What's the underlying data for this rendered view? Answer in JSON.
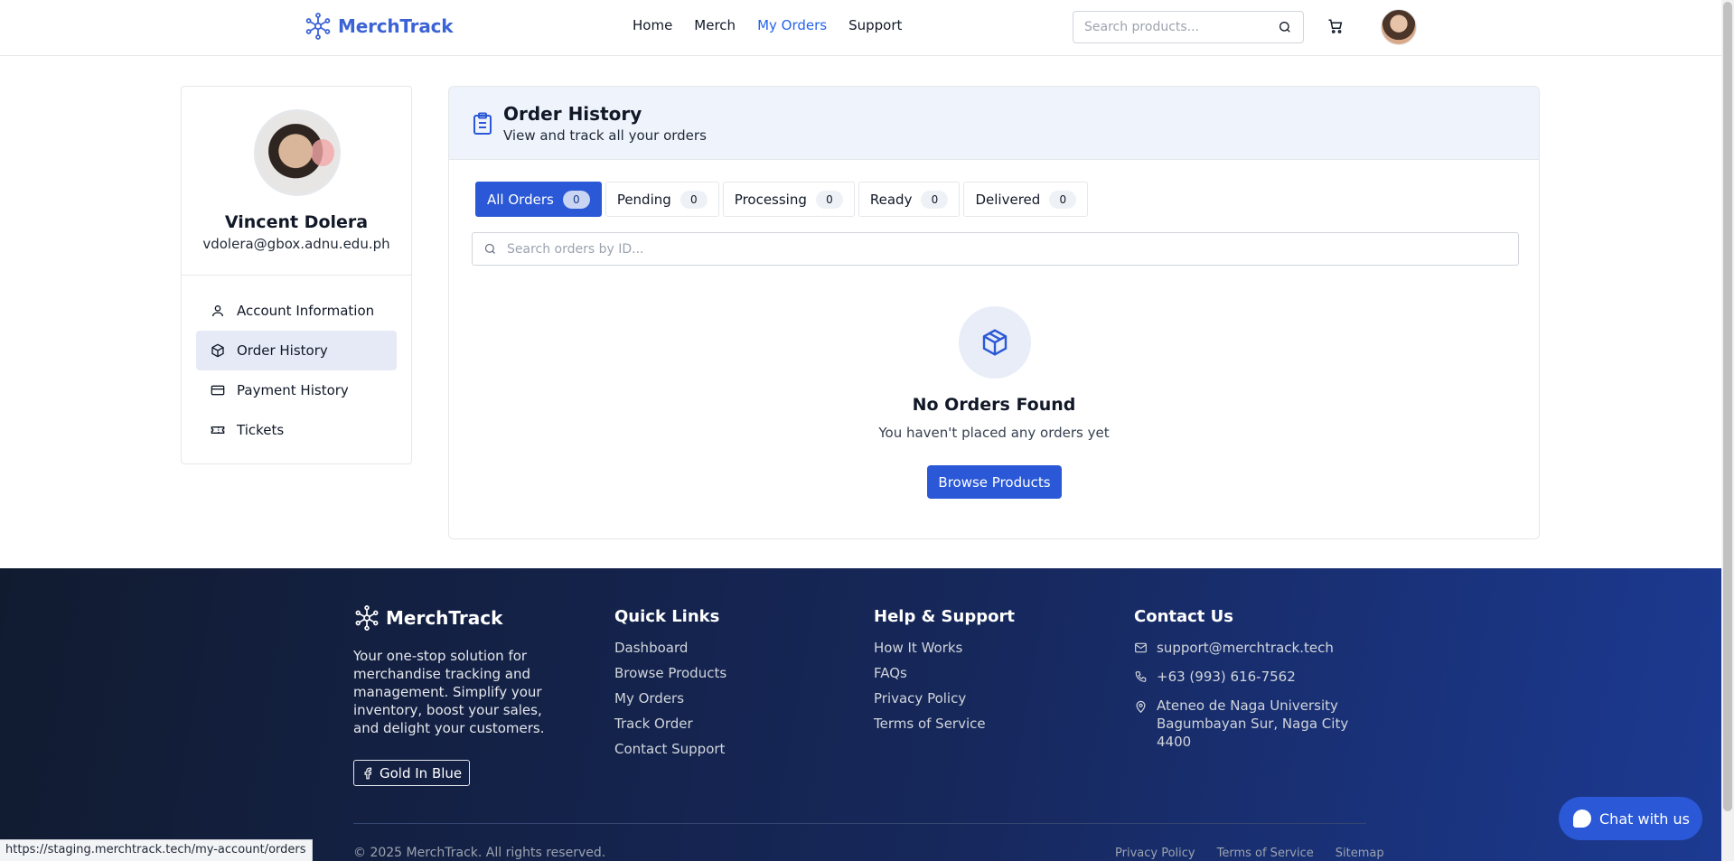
{
  "header": {
    "brand": "MerchTrack",
    "nav": [
      {
        "label": "Home",
        "active": false
      },
      {
        "label": "Merch",
        "active": false
      },
      {
        "label": "My Orders",
        "active": true
      },
      {
        "label": "Support",
        "active": false
      }
    ],
    "search_placeholder": "Search products..."
  },
  "sidebar": {
    "name": "Vincent Dolera",
    "email": "vdolera@gbox.adnu.edu.ph",
    "items": [
      {
        "label": "Account Information",
        "icon": "user-icon",
        "active": false
      },
      {
        "label": "Order History",
        "icon": "package-icon",
        "active": true
      },
      {
        "label": "Payment History",
        "icon": "credit-card-icon",
        "active": false
      },
      {
        "label": "Tickets",
        "icon": "ticket-icon",
        "active": false
      }
    ]
  },
  "orders": {
    "title": "Order History",
    "subtitle": "View and track all your orders",
    "tabs": [
      {
        "label": "All Orders",
        "count": "0",
        "active": true
      },
      {
        "label": "Pending",
        "count": "0",
        "active": false
      },
      {
        "label": "Processing",
        "count": "0",
        "active": false
      },
      {
        "label": "Ready",
        "count": "0",
        "active": false
      },
      {
        "label": "Delivered",
        "count": "0",
        "active": false
      }
    ],
    "search_placeholder": "Search orders by ID...",
    "empty_title": "No Orders Found",
    "empty_subtitle": "You haven't placed any orders yet",
    "browse_label": "Browse Products"
  },
  "footer": {
    "brand": "MerchTrack",
    "description": "Your one-stop solution for merchandise tracking and management. Simplify your inventory, boost your sales, and delight your customers.",
    "social_label": "Gold In Blue",
    "quick_links_title": "Quick Links",
    "quick_links": [
      "Dashboard",
      "Browse Products",
      "My Orders",
      "Track Order",
      "Contact Support"
    ],
    "help_title": "Help & Support",
    "help_links": [
      "How It Works",
      "FAQs",
      "Privacy Policy",
      "Terms of Service"
    ],
    "contact_title": "Contact Us",
    "email": "support@merchtrack.tech",
    "phone": "+63 (993) 616-7562",
    "address_line1": "Ateneo de Naga University",
    "address_line2": "Bagumbayan Sur, Naga City",
    "address_line3": "4400",
    "copyright": "© 2025 MerchTrack. All rights reserved.",
    "bottom_links": [
      "Privacy Policy",
      "Terms of Service",
      "Sitemap"
    ]
  },
  "chat_label": "Chat with us",
  "status_url": "https://staging.merchtrack.tech/my-account/orders",
  "colors": {
    "accent": "#2a58d6",
    "footer_dark": "#111b30",
    "footer_blue": "#1c3a92"
  }
}
